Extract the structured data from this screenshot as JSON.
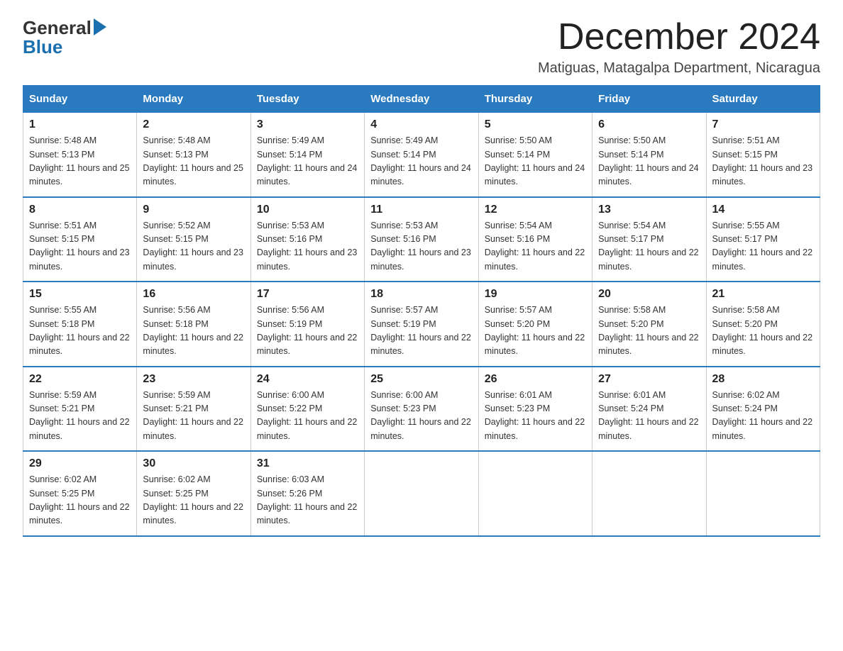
{
  "logo": {
    "line1": "General",
    "arrow": true,
    "line2": "Blue"
  },
  "title": {
    "month": "December 2024",
    "location": "Matiguas, Matagalpa Department, Nicaragua"
  },
  "weekdays": [
    "Sunday",
    "Monday",
    "Tuesday",
    "Wednesday",
    "Thursday",
    "Friday",
    "Saturday"
  ],
  "weeks": [
    [
      {
        "day": "1",
        "sunrise": "5:48 AM",
        "sunset": "5:13 PM",
        "daylight": "11 hours and 25 minutes."
      },
      {
        "day": "2",
        "sunrise": "5:48 AM",
        "sunset": "5:13 PM",
        "daylight": "11 hours and 25 minutes."
      },
      {
        "day": "3",
        "sunrise": "5:49 AM",
        "sunset": "5:14 PM",
        "daylight": "11 hours and 24 minutes."
      },
      {
        "day": "4",
        "sunrise": "5:49 AM",
        "sunset": "5:14 PM",
        "daylight": "11 hours and 24 minutes."
      },
      {
        "day": "5",
        "sunrise": "5:50 AM",
        "sunset": "5:14 PM",
        "daylight": "11 hours and 24 minutes."
      },
      {
        "day": "6",
        "sunrise": "5:50 AM",
        "sunset": "5:14 PM",
        "daylight": "11 hours and 24 minutes."
      },
      {
        "day": "7",
        "sunrise": "5:51 AM",
        "sunset": "5:15 PM",
        "daylight": "11 hours and 23 minutes."
      }
    ],
    [
      {
        "day": "8",
        "sunrise": "5:51 AM",
        "sunset": "5:15 PM",
        "daylight": "11 hours and 23 minutes."
      },
      {
        "day": "9",
        "sunrise": "5:52 AM",
        "sunset": "5:15 PM",
        "daylight": "11 hours and 23 minutes."
      },
      {
        "day": "10",
        "sunrise": "5:53 AM",
        "sunset": "5:16 PM",
        "daylight": "11 hours and 23 minutes."
      },
      {
        "day": "11",
        "sunrise": "5:53 AM",
        "sunset": "5:16 PM",
        "daylight": "11 hours and 23 minutes."
      },
      {
        "day": "12",
        "sunrise": "5:54 AM",
        "sunset": "5:16 PM",
        "daylight": "11 hours and 22 minutes."
      },
      {
        "day": "13",
        "sunrise": "5:54 AM",
        "sunset": "5:17 PM",
        "daylight": "11 hours and 22 minutes."
      },
      {
        "day": "14",
        "sunrise": "5:55 AM",
        "sunset": "5:17 PM",
        "daylight": "11 hours and 22 minutes."
      }
    ],
    [
      {
        "day": "15",
        "sunrise": "5:55 AM",
        "sunset": "5:18 PM",
        "daylight": "11 hours and 22 minutes."
      },
      {
        "day": "16",
        "sunrise": "5:56 AM",
        "sunset": "5:18 PM",
        "daylight": "11 hours and 22 minutes."
      },
      {
        "day": "17",
        "sunrise": "5:56 AM",
        "sunset": "5:19 PM",
        "daylight": "11 hours and 22 minutes."
      },
      {
        "day": "18",
        "sunrise": "5:57 AM",
        "sunset": "5:19 PM",
        "daylight": "11 hours and 22 minutes."
      },
      {
        "day": "19",
        "sunrise": "5:57 AM",
        "sunset": "5:20 PM",
        "daylight": "11 hours and 22 minutes."
      },
      {
        "day": "20",
        "sunrise": "5:58 AM",
        "sunset": "5:20 PM",
        "daylight": "11 hours and 22 minutes."
      },
      {
        "day": "21",
        "sunrise": "5:58 AM",
        "sunset": "5:20 PM",
        "daylight": "11 hours and 22 minutes."
      }
    ],
    [
      {
        "day": "22",
        "sunrise": "5:59 AM",
        "sunset": "5:21 PM",
        "daylight": "11 hours and 22 minutes."
      },
      {
        "day": "23",
        "sunrise": "5:59 AM",
        "sunset": "5:21 PM",
        "daylight": "11 hours and 22 minutes."
      },
      {
        "day": "24",
        "sunrise": "6:00 AM",
        "sunset": "5:22 PM",
        "daylight": "11 hours and 22 minutes."
      },
      {
        "day": "25",
        "sunrise": "6:00 AM",
        "sunset": "5:23 PM",
        "daylight": "11 hours and 22 minutes."
      },
      {
        "day": "26",
        "sunrise": "6:01 AM",
        "sunset": "5:23 PM",
        "daylight": "11 hours and 22 minutes."
      },
      {
        "day": "27",
        "sunrise": "6:01 AM",
        "sunset": "5:24 PM",
        "daylight": "11 hours and 22 minutes."
      },
      {
        "day": "28",
        "sunrise": "6:02 AM",
        "sunset": "5:24 PM",
        "daylight": "11 hours and 22 minutes."
      }
    ],
    [
      {
        "day": "29",
        "sunrise": "6:02 AM",
        "sunset": "5:25 PM",
        "daylight": "11 hours and 22 minutes."
      },
      {
        "day": "30",
        "sunrise": "6:02 AM",
        "sunset": "5:25 PM",
        "daylight": "11 hours and 22 minutes."
      },
      {
        "day": "31",
        "sunrise": "6:03 AM",
        "sunset": "5:26 PM",
        "daylight": "11 hours and 22 minutes."
      },
      null,
      null,
      null,
      null
    ]
  ]
}
